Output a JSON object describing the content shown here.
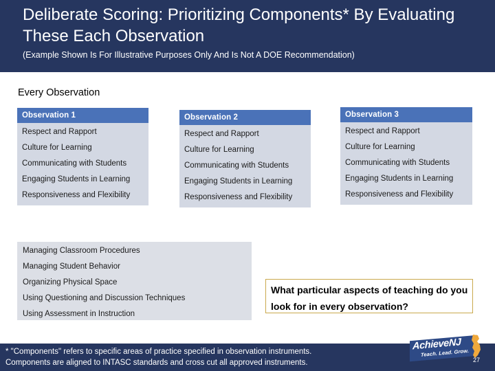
{
  "title": {
    "main": "Deliberate Scoring: Prioritizing Components*  By Evaluating These Each Observation",
    "subtitle": "(Example Shown Is For Illustrative Purposes Only And Is Not A DOE Recommendation)"
  },
  "section": {
    "heading": "Every Observation"
  },
  "columns": [
    {
      "header": "Observation 1",
      "items": [
        "Respect and Rapport",
        "Culture for Learning",
        "Communicating with Students",
        "Engaging Students in Learning",
        "Responsiveness and Flexibility"
      ]
    },
    {
      "header": "Observation 2",
      "items": [
        "Respect and Rapport",
        "Culture for Learning",
        "Communicating with Students",
        "Engaging Students in Learning",
        "Responsiveness and Flexibility"
      ]
    },
    {
      "header": "Observation 3",
      "items": [
        "Respect and Rapport",
        "Culture for Learning",
        "Communicating with Students",
        "Engaging Students in Learning",
        "Responsiveness and Flexibility"
      ]
    }
  ],
  "lower_list": {
    "items": [
      "Managing Classroom Procedures",
      "Managing Student Behavior",
      "Organizing Physical Space",
      "Using Questioning and Discussion Techniques",
      "Using Assessment in Instruction"
    ]
  },
  "question": {
    "text": "What particular aspects of teaching do you look for in every observation?"
  },
  "footer": {
    "line1": "* \"Components\" refers to specific areas of practice specified in observation instruments.",
    "line2": "Components are aligned to INTASC standards and cross cut all approved instruments."
  },
  "logo": {
    "name": "AchieveNJ",
    "tagline": "Teach. Lead. Grow.",
    "page_number": "27"
  },
  "colors": {
    "band_blue": "#26365f",
    "header_blue": "#4a72b8",
    "column_bg": "#d3d8e3",
    "lower_list_bg": "#dcdfe6",
    "callout_border": "#c9a84c",
    "logo_ribbon": "#2e4a86",
    "logo_nj": "#f0a93c"
  }
}
